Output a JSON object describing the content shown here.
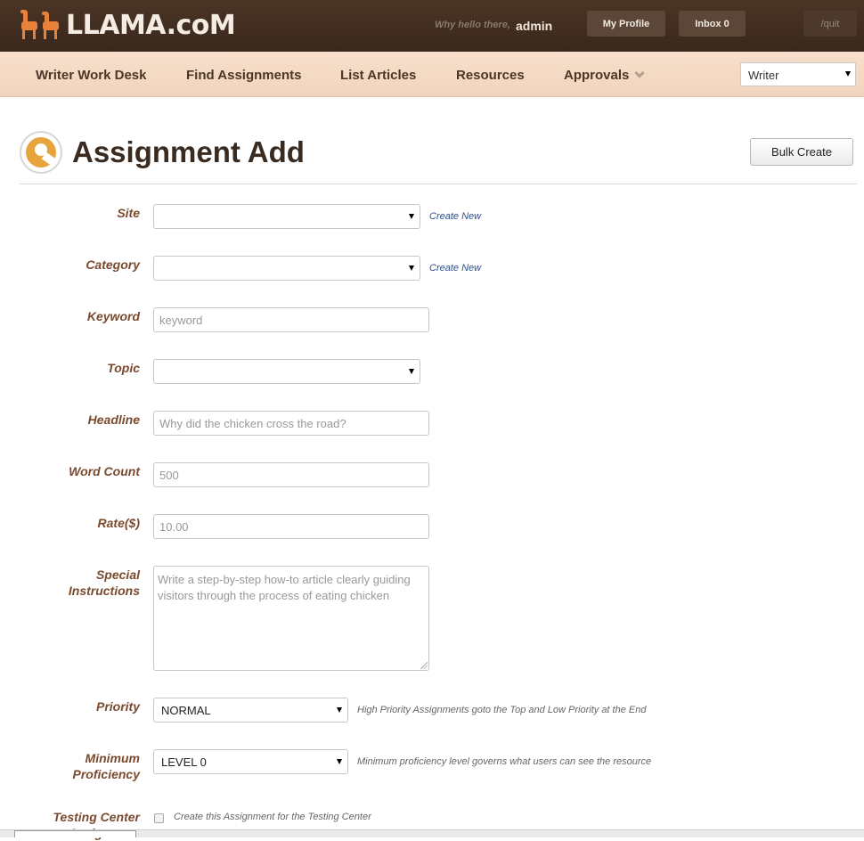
{
  "header": {
    "logo_text": "LLAMA.coM",
    "greeting": "Why hello there,",
    "username": "admin",
    "buttons": {
      "profile": "My Profile",
      "inbox": "Inbox 0",
      "quit": "/quit"
    }
  },
  "nav": {
    "items": [
      "Writer Work Desk",
      "Find Assignments",
      "List Articles",
      "Resources",
      "Approvals"
    ],
    "role_select": "Writer"
  },
  "page": {
    "title": "Assignment Add",
    "bulk_create": "Bulk Create"
  },
  "form": {
    "create_new": "Create New",
    "site": {
      "label": "Site",
      "value": ""
    },
    "category": {
      "label": "Category",
      "value": ""
    },
    "keyword": {
      "label": "Keyword",
      "placeholder": "keyword"
    },
    "topic": {
      "label": "Topic",
      "value": ""
    },
    "headline": {
      "label": "Headline",
      "placeholder": "Why did the chicken cross the road?"
    },
    "word_count": {
      "label": "Word Count",
      "placeholder": "500"
    },
    "rate": {
      "label": "Rate($)",
      "placeholder": "10.00"
    },
    "special_instructions": {
      "label_line1": "Special",
      "label_line2": "Instructions",
      "placeholder": "Write a step-by-step how-to article clearly guiding visitors through the process of eating chicken"
    },
    "priority": {
      "label": "Priority",
      "value": "NORMAL",
      "hint": "High Priority Assignments goto the Top and Low Priority at the End"
    },
    "minimum_proficiency": {
      "label_line1": "Minimum",
      "label_line2": "Proficiency",
      "value": "LEVEL 0",
      "hint": "Minimum proficiency level governs what users can see the resource"
    },
    "testing_center": {
      "label_line1": "Testing Center",
      "label_line2": "Assignment",
      "checkbox_label": "Create this Assignment for the Testing Center"
    }
  },
  "colors": {
    "topbar": "#3f2c1f",
    "navbar": "#f4d8c1",
    "accent": "#e8a43c",
    "label": "#7a4a2e",
    "link": "#2c4f8a"
  }
}
